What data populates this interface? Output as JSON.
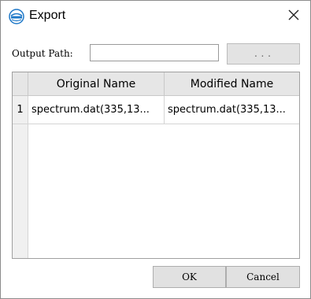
{
  "window": {
    "title": "Export",
    "app_icon": "app-logo-icon",
    "close_icon": "close-icon"
  },
  "output_path": {
    "label": "Output Path:",
    "value": "",
    "browse_label": "..."
  },
  "table": {
    "columns": [
      "Original Name",
      "Modified Name"
    ],
    "rows": [
      {
        "index": "1",
        "original": "spectrum.dat(335,13...",
        "modified": "spectrum.dat(335,13..."
      }
    ]
  },
  "buttons": {
    "ok_label": "OK",
    "cancel_label": "Cancel"
  },
  "colors": {
    "accent": "#1e78c8",
    "header_bg": "#e6e6e6",
    "button_bg": "#e1e1e1"
  }
}
